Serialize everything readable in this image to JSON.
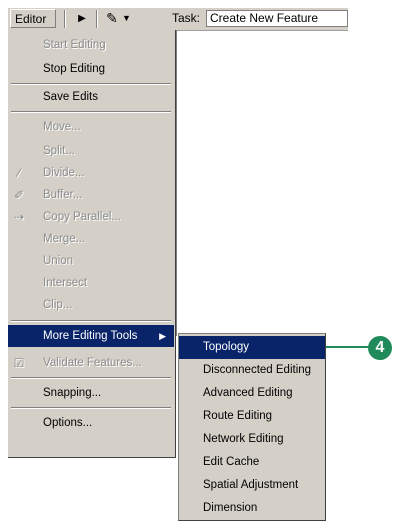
{
  "toolbar": {
    "editor_label": "Editor",
    "editor_arrow": "▼",
    "pointer_icon": "▶",
    "pencil_icon": "✎",
    "pencil_arrow": "▼",
    "task_label": "Task:",
    "task_value": "Create New Feature"
  },
  "menu": {
    "items": [
      {
        "label": "Start Editing",
        "enabled": false
      },
      {
        "label": "Stop Editing",
        "enabled": true
      },
      {
        "label": "Save Edits",
        "enabled": true
      },
      {
        "label": "Move...",
        "enabled": false
      },
      {
        "label": "Split...",
        "enabled": false
      },
      {
        "label": "Divide...",
        "enabled": false,
        "icon": "divide-icon"
      },
      {
        "label": "Buffer...",
        "enabled": false,
        "icon": "buffer-icon"
      },
      {
        "label": "Copy Parallel...",
        "enabled": false,
        "icon": "copy-parallel-icon"
      },
      {
        "label": "Merge...",
        "enabled": false
      },
      {
        "label": "Union",
        "enabled": false
      },
      {
        "label": "Intersect",
        "enabled": false
      },
      {
        "label": "Clip...",
        "enabled": false
      },
      {
        "label": "More Editing Tools",
        "enabled": true,
        "highlighted": true,
        "has_submenu": true
      },
      {
        "label": "Validate Features...",
        "enabled": false,
        "icon": "validate-icon"
      },
      {
        "label": "Snapping...",
        "enabled": true
      },
      {
        "label": "Options...",
        "enabled": true
      }
    ]
  },
  "submenu": {
    "items": [
      {
        "label": "Topology",
        "highlighted": true
      },
      {
        "label": "Disconnected Editing"
      },
      {
        "label": "Advanced Editing"
      },
      {
        "label": "Route Editing"
      },
      {
        "label": "Network Editing"
      },
      {
        "label": "Edit Cache"
      },
      {
        "label": "Spatial Adjustment"
      },
      {
        "label": "Dimension"
      }
    ]
  },
  "callout": {
    "number": "4"
  },
  "colors": {
    "highlight": "#0a246a",
    "menu_bg": "#d4d0c8",
    "disabled_text": "#8d8d8d",
    "callout": "#1f8a5a"
  }
}
